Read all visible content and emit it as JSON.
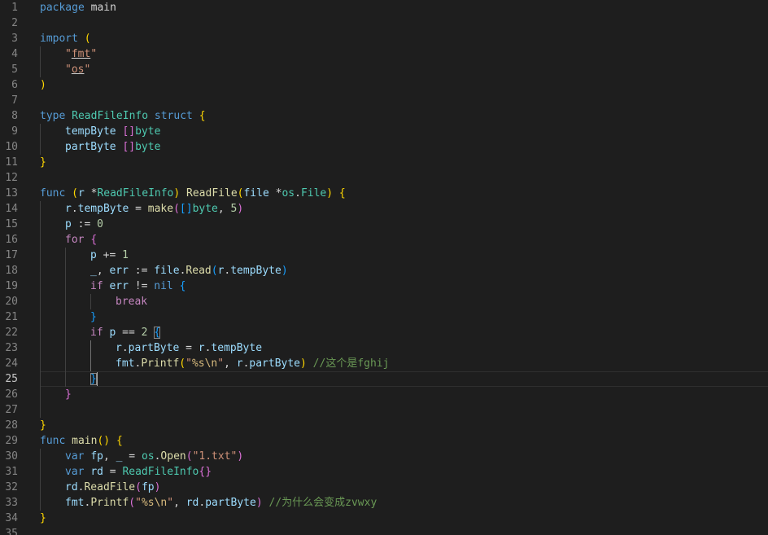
{
  "editor": {
    "language": "go",
    "current_line": 25,
    "colors": {
      "background": "#1e1e1e",
      "line_number": "#858585",
      "keyword": "#569cd6",
      "control": "#c586c0",
      "function": "#dcdcaa",
      "variable": "#9cdcfe",
      "type": "#4ec9b0",
      "string": "#ce9178",
      "number": "#b5cea8",
      "comment": "#6a9955",
      "bracket_level1": "#ffd700",
      "bracket_level2": "#da70d6",
      "bracket_level3": "#179fff"
    },
    "lines": [
      {
        "num": "1",
        "indent": 0,
        "tokens": [
          [
            "k",
            "package"
          ],
          [
            "p",
            " main"
          ]
        ]
      },
      {
        "num": "2",
        "indent": 0,
        "tokens": []
      },
      {
        "num": "3",
        "indent": 0,
        "tokens": [
          [
            "k",
            "import"
          ],
          [
            "p",
            " "
          ],
          [
            "b1",
            "("
          ]
        ]
      },
      {
        "num": "4",
        "indent": 1,
        "tokens": [
          [
            "s",
            "\""
          ],
          [
            "s u",
            "fmt"
          ],
          [
            "s",
            "\""
          ]
        ]
      },
      {
        "num": "5",
        "indent": 1,
        "tokens": [
          [
            "s",
            "\""
          ],
          [
            "s u",
            "os"
          ],
          [
            "s",
            "\""
          ]
        ]
      },
      {
        "num": "6",
        "indent": 0,
        "tokens": [
          [
            "b1",
            ")"
          ]
        ]
      },
      {
        "num": "7",
        "indent": 0,
        "tokens": []
      },
      {
        "num": "8",
        "indent": 0,
        "tokens": [
          [
            "k",
            "type"
          ],
          [
            "p",
            " "
          ],
          [
            "t",
            "ReadFileInfo"
          ],
          [
            "p",
            " "
          ],
          [
            "k",
            "struct"
          ],
          [
            "p",
            " "
          ],
          [
            "b1",
            "{"
          ]
        ]
      },
      {
        "num": "9",
        "indent": 1,
        "tokens": [
          [
            "v",
            "tempByte"
          ],
          [
            "p",
            " "
          ],
          [
            "b2",
            "[]"
          ],
          [
            "t",
            "byte"
          ]
        ]
      },
      {
        "num": "10",
        "indent": 1,
        "tokens": [
          [
            "v",
            "partByte"
          ],
          [
            "p",
            " "
          ],
          [
            "b2",
            "[]"
          ],
          [
            "t",
            "byte"
          ]
        ]
      },
      {
        "num": "11",
        "indent": 0,
        "tokens": [
          [
            "b1",
            "}"
          ]
        ]
      },
      {
        "num": "12",
        "indent": 0,
        "tokens": []
      },
      {
        "num": "13",
        "indent": 0,
        "tokens": [
          [
            "k",
            "func"
          ],
          [
            "p",
            " "
          ],
          [
            "b1",
            "("
          ],
          [
            "v",
            "r"
          ],
          [
            "p",
            " *"
          ],
          [
            "t",
            "ReadFileInfo"
          ],
          [
            "b1",
            ")"
          ],
          [
            "p",
            " "
          ],
          [
            "f",
            "ReadFile"
          ],
          [
            "b1",
            "("
          ],
          [
            "v",
            "file"
          ],
          [
            "p",
            " *"
          ],
          [
            "t",
            "os"
          ],
          [
            "p",
            "."
          ],
          [
            "t",
            "File"
          ],
          [
            "b1",
            ")"
          ],
          [
            "p",
            " "
          ],
          [
            "b1",
            "{"
          ]
        ]
      },
      {
        "num": "14",
        "indent": 1,
        "tokens": [
          [
            "v",
            "r"
          ],
          [
            "p",
            "."
          ],
          [
            "v",
            "tempByte"
          ],
          [
            "p",
            " = "
          ],
          [
            "f",
            "make"
          ],
          [
            "b2",
            "("
          ],
          [
            "b3",
            "[]"
          ],
          [
            "t",
            "byte"
          ],
          [
            "p",
            ", "
          ],
          [
            "n",
            "5"
          ],
          [
            "b2",
            ")"
          ]
        ]
      },
      {
        "num": "15",
        "indent": 1,
        "tokens": [
          [
            "v",
            "p"
          ],
          [
            "p",
            " := "
          ],
          [
            "n",
            "0"
          ]
        ]
      },
      {
        "num": "16",
        "indent": 1,
        "tokens": [
          [
            "c",
            "for"
          ],
          [
            "p",
            " "
          ],
          [
            "b2",
            "{"
          ]
        ]
      },
      {
        "num": "17",
        "indent": 2,
        "tokens": [
          [
            "v",
            "p"
          ],
          [
            "p",
            " += "
          ],
          [
            "n",
            "1"
          ]
        ]
      },
      {
        "num": "18",
        "indent": 2,
        "tokens": [
          [
            "v",
            "_"
          ],
          [
            "p",
            ", "
          ],
          [
            "v",
            "err"
          ],
          [
            "p",
            " := "
          ],
          [
            "v",
            "file"
          ],
          [
            "p",
            "."
          ],
          [
            "f",
            "Read"
          ],
          [
            "b3",
            "("
          ],
          [
            "v",
            "r"
          ],
          [
            "p",
            "."
          ],
          [
            "v",
            "tempByte"
          ],
          [
            "b3",
            ")"
          ]
        ]
      },
      {
        "num": "19",
        "indent": 2,
        "tokens": [
          [
            "c",
            "if"
          ],
          [
            "p",
            " "
          ],
          [
            "v",
            "err"
          ],
          [
            "p",
            " != "
          ],
          [
            "k",
            "nil"
          ],
          [
            "p",
            " "
          ],
          [
            "b3",
            "{"
          ]
        ]
      },
      {
        "num": "20",
        "indent": 3,
        "tokens": [
          [
            "c",
            "break"
          ]
        ]
      },
      {
        "num": "21",
        "indent": 2,
        "tokens": [
          [
            "b3",
            "}"
          ]
        ]
      },
      {
        "num": "22",
        "indent": 2,
        "tokens": [
          [
            "c",
            "if"
          ],
          [
            "p",
            " "
          ],
          [
            "v",
            "p"
          ],
          [
            "p",
            " == "
          ],
          [
            "n",
            "2"
          ],
          [
            "p",
            " "
          ],
          [
            "b3 match",
            "{"
          ]
        ]
      },
      {
        "num": "23",
        "indent": 3,
        "tokens": [
          [
            "v",
            "r"
          ],
          [
            "p",
            "."
          ],
          [
            "v",
            "partByte"
          ],
          [
            "p",
            " = "
          ],
          [
            "v",
            "r"
          ],
          [
            "p",
            "."
          ],
          [
            "v",
            "tempByte"
          ]
        ]
      },
      {
        "num": "24",
        "indent": 3,
        "tokens": [
          [
            "v",
            "fmt"
          ],
          [
            "p",
            "."
          ],
          [
            "f",
            "Printf"
          ],
          [
            "b1",
            "("
          ],
          [
            "s",
            "\""
          ],
          [
            "e",
            "%s\\n"
          ],
          [
            "s",
            "\""
          ],
          [
            "p",
            ", "
          ],
          [
            "v",
            "r"
          ],
          [
            "p",
            "."
          ],
          [
            "v",
            "partByte"
          ],
          [
            "b1",
            ")"
          ],
          [
            "p",
            " "
          ],
          [
            "cm",
            "//这个是fghij"
          ]
        ]
      },
      {
        "num": "25",
        "indent": 2,
        "tokens": [
          [
            "b3 match",
            "}"
          ],
          [
            "cursor",
            ""
          ]
        ]
      },
      {
        "num": "26",
        "indent": 1,
        "tokens": [
          [
            "b2",
            "}"
          ]
        ]
      },
      {
        "num": "27",
        "indent": 1,
        "tokens": []
      },
      {
        "num": "28",
        "indent": 0,
        "tokens": [
          [
            "b1",
            "}"
          ]
        ]
      },
      {
        "num": "29",
        "indent": 0,
        "tokens": [
          [
            "k",
            "func"
          ],
          [
            "p",
            " "
          ],
          [
            "f",
            "main"
          ],
          [
            "b1",
            "()"
          ],
          [
            "p",
            " "
          ],
          [
            "b1",
            "{"
          ]
        ]
      },
      {
        "num": "30",
        "indent": 1,
        "tokens": [
          [
            "k",
            "var"
          ],
          [
            "p",
            " "
          ],
          [
            "v",
            "fp"
          ],
          [
            "p",
            ", "
          ],
          [
            "v",
            "_"
          ],
          [
            "p",
            " = "
          ],
          [
            "t",
            "os"
          ],
          [
            "p",
            "."
          ],
          [
            "f",
            "Open"
          ],
          [
            "b2",
            "("
          ],
          [
            "s",
            "\"1.txt\""
          ],
          [
            "b2",
            ")"
          ]
        ]
      },
      {
        "num": "31",
        "indent": 1,
        "tokens": [
          [
            "k",
            "var"
          ],
          [
            "p",
            " "
          ],
          [
            "v",
            "rd"
          ],
          [
            "p",
            " = "
          ],
          [
            "t",
            "ReadFileInfo"
          ],
          [
            "b2",
            "{}"
          ]
        ]
      },
      {
        "num": "32",
        "indent": 1,
        "tokens": [
          [
            "v",
            "rd"
          ],
          [
            "p",
            "."
          ],
          [
            "f",
            "ReadFile"
          ],
          [
            "b2",
            "("
          ],
          [
            "v",
            "fp"
          ],
          [
            "b2",
            ")"
          ]
        ]
      },
      {
        "num": "33",
        "indent": 1,
        "tokens": [
          [
            "v",
            "fmt"
          ],
          [
            "p",
            "."
          ],
          [
            "f",
            "Printf"
          ],
          [
            "b2",
            "("
          ],
          [
            "s",
            "\""
          ],
          [
            "e",
            "%s\\n"
          ],
          [
            "s",
            "\""
          ],
          [
            "p",
            ", "
          ],
          [
            "v",
            "rd"
          ],
          [
            "p",
            "."
          ],
          [
            "v",
            "partByte"
          ],
          [
            "b2",
            ")"
          ],
          [
            "p",
            " "
          ],
          [
            "cm",
            "//为什么会变成zvwxy"
          ]
        ]
      },
      {
        "num": "34",
        "indent": 0,
        "tokens": [
          [
            "b1",
            "}"
          ]
        ]
      },
      {
        "num": "35",
        "indent": 0,
        "tokens": []
      }
    ]
  }
}
